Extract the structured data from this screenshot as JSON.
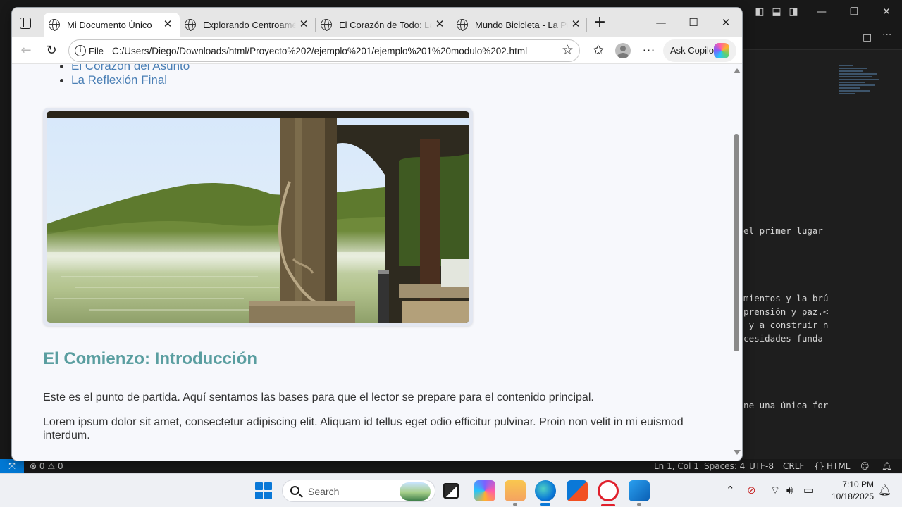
{
  "browser": {
    "tabs": [
      {
        "title": "Mi Documento Único",
        "active": true
      },
      {
        "title": "Explorando Centroamérica",
        "active": false
      },
      {
        "title": "El Corazón de Todo: La Fase Final",
        "active": false
      },
      {
        "title": "Mundo Bicicleta - La Pasión",
        "active": false
      }
    ],
    "address": {
      "scheme_chip": "File",
      "url": "C:/Users/Diego/Downloads/html/Proyecto%202/ejemplo%201/ejemplo%201%20modulo%202.html"
    },
    "copilot_label": "Ask Copilot"
  },
  "page": {
    "toc": [
      "El Corazón del Asunto",
      "La Reflexión Final"
    ],
    "section_title": "El Comienzo: Introducción",
    "paragraphs": [
      "Este es el punto de partida. Aquí sentamos las bases para que el lector se prepare para el contenido principal.",
      "Lorem ipsum dolor sit amet, consectetur adipiscing elit. Aliquam id tellus eget odio efficitur pulvinar. Proin non velit in mi euismod interdum."
    ],
    "colors": {
      "heading": "#5a9ea0",
      "link": "#4a7fb5",
      "background": "#f7f8fc"
    }
  },
  "editor": {
    "code_fragments": [
      "s el primer lugar",
      "cimientos y la brú",
      "omprensión y paz.<",
      "do y a construir n",
      "necesidades funda",
      "iene una única for"
    ],
    "status": {
      "errors": "0",
      "warnings": "0",
      "position": "Ln 1, Col 1",
      "spaces": "Spaces: 4",
      "encoding": "UTF-8",
      "eol": "CRLF",
      "language": "HTML"
    }
  },
  "taskbar": {
    "search_placeholder": "Search",
    "time": "7:10 PM",
    "date": "10/18/2025"
  }
}
